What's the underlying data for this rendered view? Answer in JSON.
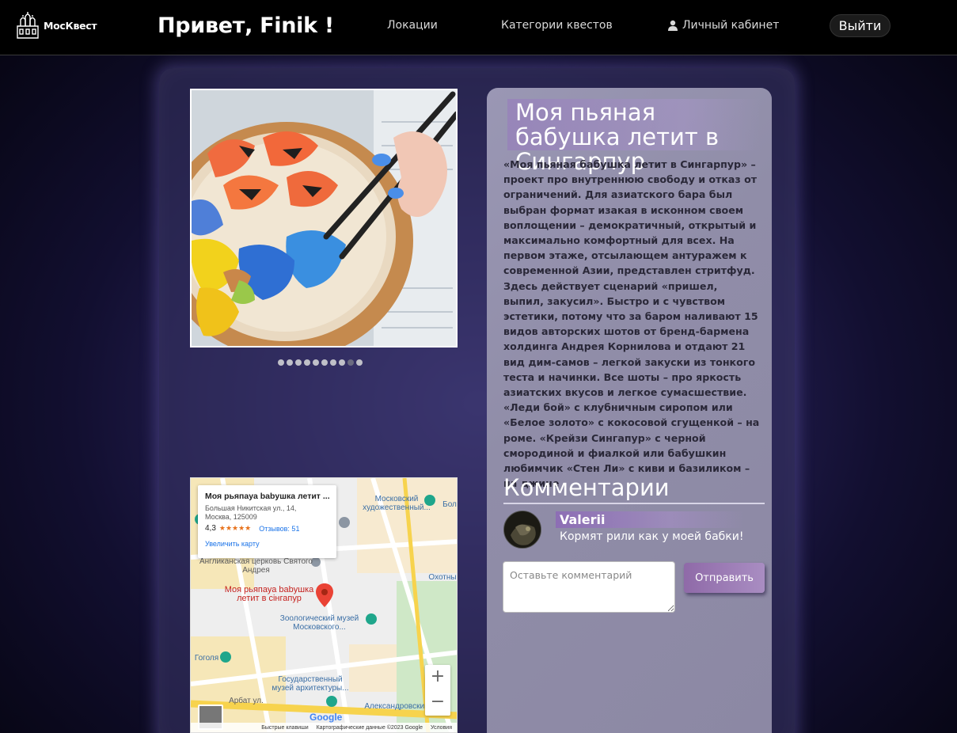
{
  "header": {
    "logo_text": "МосКвест",
    "greeting": "Привет, Finik !",
    "nav": {
      "locations": "Локации",
      "categories": "Категории квестов",
      "cabinet": "Личный кабинет"
    },
    "logout_label": "Выйти"
  },
  "gallery": {
    "slide_count": 10,
    "active_index": 8
  },
  "map": {
    "info_title": "Моя рьяпауа babушка летит ...",
    "info_address_line1": "Большая Никитская ул., 14,",
    "info_address_line2": "Москва, 125009",
    "info_rating": "4,3",
    "info_stars": "★★★★★",
    "info_reviews": "Отзывов: 51",
    "info_zoom_link": "Увеличить карту",
    "labels": {
      "museum_top": "Московский художественный...",
      "church": "Англиканская церковь Святого Андрея",
      "place_marker": "Моя рьяпауа babушка летит в сiнгапур",
      "zoo_museum": "Зоологический музей Московского...",
      "arch_museum": "Государственный музей архитектуры...",
      "gogol": "Гоголя",
      "alexandrovsky": "Александровский",
      "street_arbat": "Арбат ул.",
      "okhotny": "Охотны",
      "bol": "Бол"
    },
    "zoom_in": "+",
    "zoom_out": "−",
    "google": "Google",
    "footer_shortcuts": "Быстрые клавиши",
    "footer_data": "Картографические данные ©2023 Google",
    "footer_terms": "Условия"
  },
  "quest": {
    "title": "Моя пьяная бабушка летит в Сингарпур",
    "description": "«Моя пьяная бабушка летит в Сингарпур» – проект про внутреннюю свободу и отказ от ограничений. Для азиатского бара был выбран формат изакая в исконном своем воплощении – демократичный, открытый и максимально комфортный для всех. На первом этаже, отсылающем антуражем к современной Азии, представлен стритфуд. Здесь действует сценарий «пришел, выпил, закусил». Быстро и с чувством эстетики, потому что за баром наливают 15 видов авторских шотов от бренд-бармена холдинга Андрея Корнилова и отдают 21 вид дим-самов – легкой закуски из тонкого теста и начинки. Все шоты – про яркость азиатских вкусов и легкое сумасшествие. «Леди бой» с клубничным сиропом или «Белое золото» с кокосовой сгущенкой – на роме. «Крейзи Сингапур» с черной смородиной и фиалкой или бабушкин любимчик «Стен Ли» с киви и базиликом – на джине"
  },
  "comments": {
    "heading": "Комментарии",
    "items": [
      {
        "author": "Valerii",
        "text": "Кормят рили как у моей бабки!"
      }
    ],
    "input_placeholder": "Оставьте комментарий",
    "input_value": "",
    "send_label": "Отправить"
  },
  "colors": {
    "header_bg": "#000000",
    "panel_bg": "#9a97b4",
    "accent_purple": "#8f6aa8",
    "card_glow": "#786ec8"
  }
}
